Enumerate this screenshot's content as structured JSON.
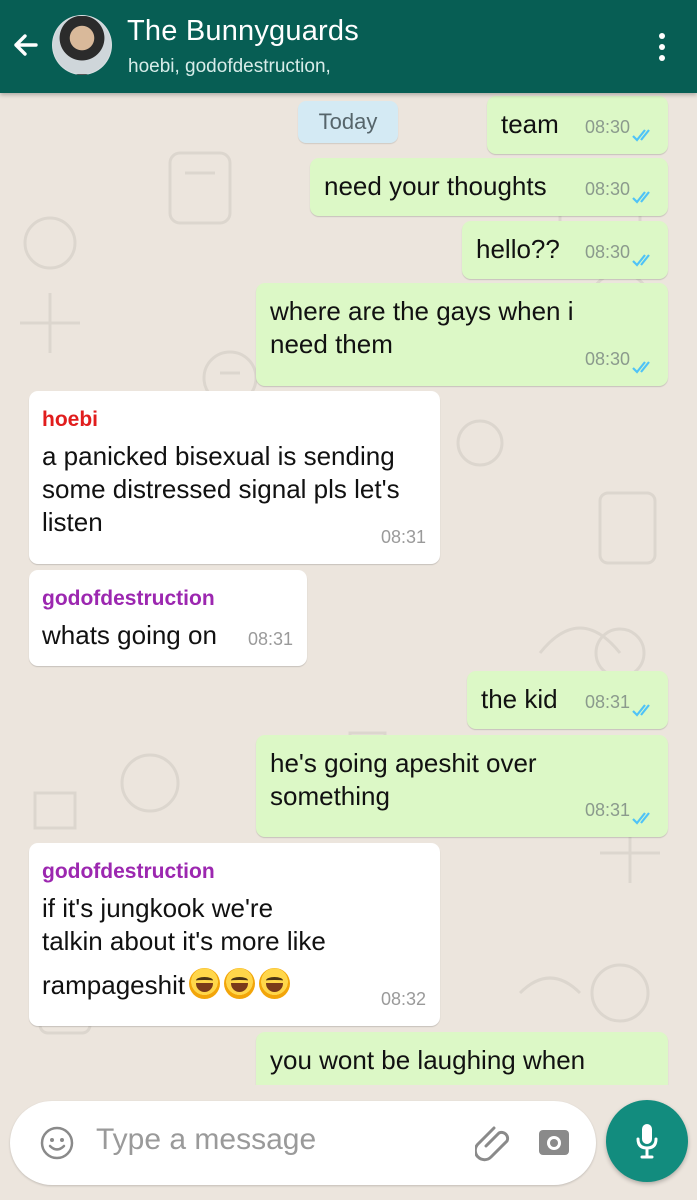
{
  "header": {
    "title": "The Bunnyguards",
    "subtitle": "hoebi, godofdestruction,",
    "color": "#075E54"
  },
  "date_chip": "Today",
  "messages": [
    {
      "direction": "out",
      "text": "team",
      "time": "08:30",
      "status": "read"
    },
    {
      "direction": "out",
      "text": "need your thoughts",
      "time": "08:30",
      "status": "read"
    },
    {
      "direction": "out",
      "text": "hello??",
      "time": "08:30",
      "status": "read"
    },
    {
      "direction": "out",
      "lines": [
        "where are the gays when i",
        "need them"
      ],
      "time": "08:30",
      "status": "read"
    },
    {
      "direction": "in",
      "sender": "hoebi",
      "sender_color": "#E11D1D",
      "lines": [
        "a panicked bisexual is sending",
        "some distressed signal pls let's",
        "listen"
      ],
      "time": "08:31"
    },
    {
      "direction": "in",
      "sender": "godofdestruction",
      "sender_color": "#9C27B0",
      "text": "whats going on",
      "time": "08:31"
    },
    {
      "direction": "out",
      "text": "the kid",
      "time": "08:31",
      "status": "read"
    },
    {
      "direction": "out",
      "lines": [
        "he's going apeshit over",
        "something"
      ],
      "time": "08:31",
      "status": "read"
    },
    {
      "direction": "in",
      "sender": "godofdestruction",
      "sender_color": "#9C27B0",
      "lines": [
        "if it's jungkook we're",
        "talkin about it's more like",
        "rampageshit"
      ],
      "emojis": [
        "face-with-tears-of-joy",
        "face-with-tears-of-joy",
        "face-with-tears-of-joy"
      ],
      "time": "08:32"
    },
    {
      "direction": "out",
      "text": "you wont be laughing when",
      "status": "partially visible"
    }
  ],
  "composer": {
    "placeholder": "Type a message",
    "icons": [
      "emoji-icon",
      "attach-icon",
      "camera-icon"
    ],
    "send_icon": "microphone-icon",
    "accent": "#128C7E"
  },
  "colors": {
    "outgoing_bubble": "#DCF8C6",
    "incoming_bubble": "#FFFFFF",
    "chat_background": "#ECE5DD",
    "read_tick": "#4FC3F7"
  }
}
